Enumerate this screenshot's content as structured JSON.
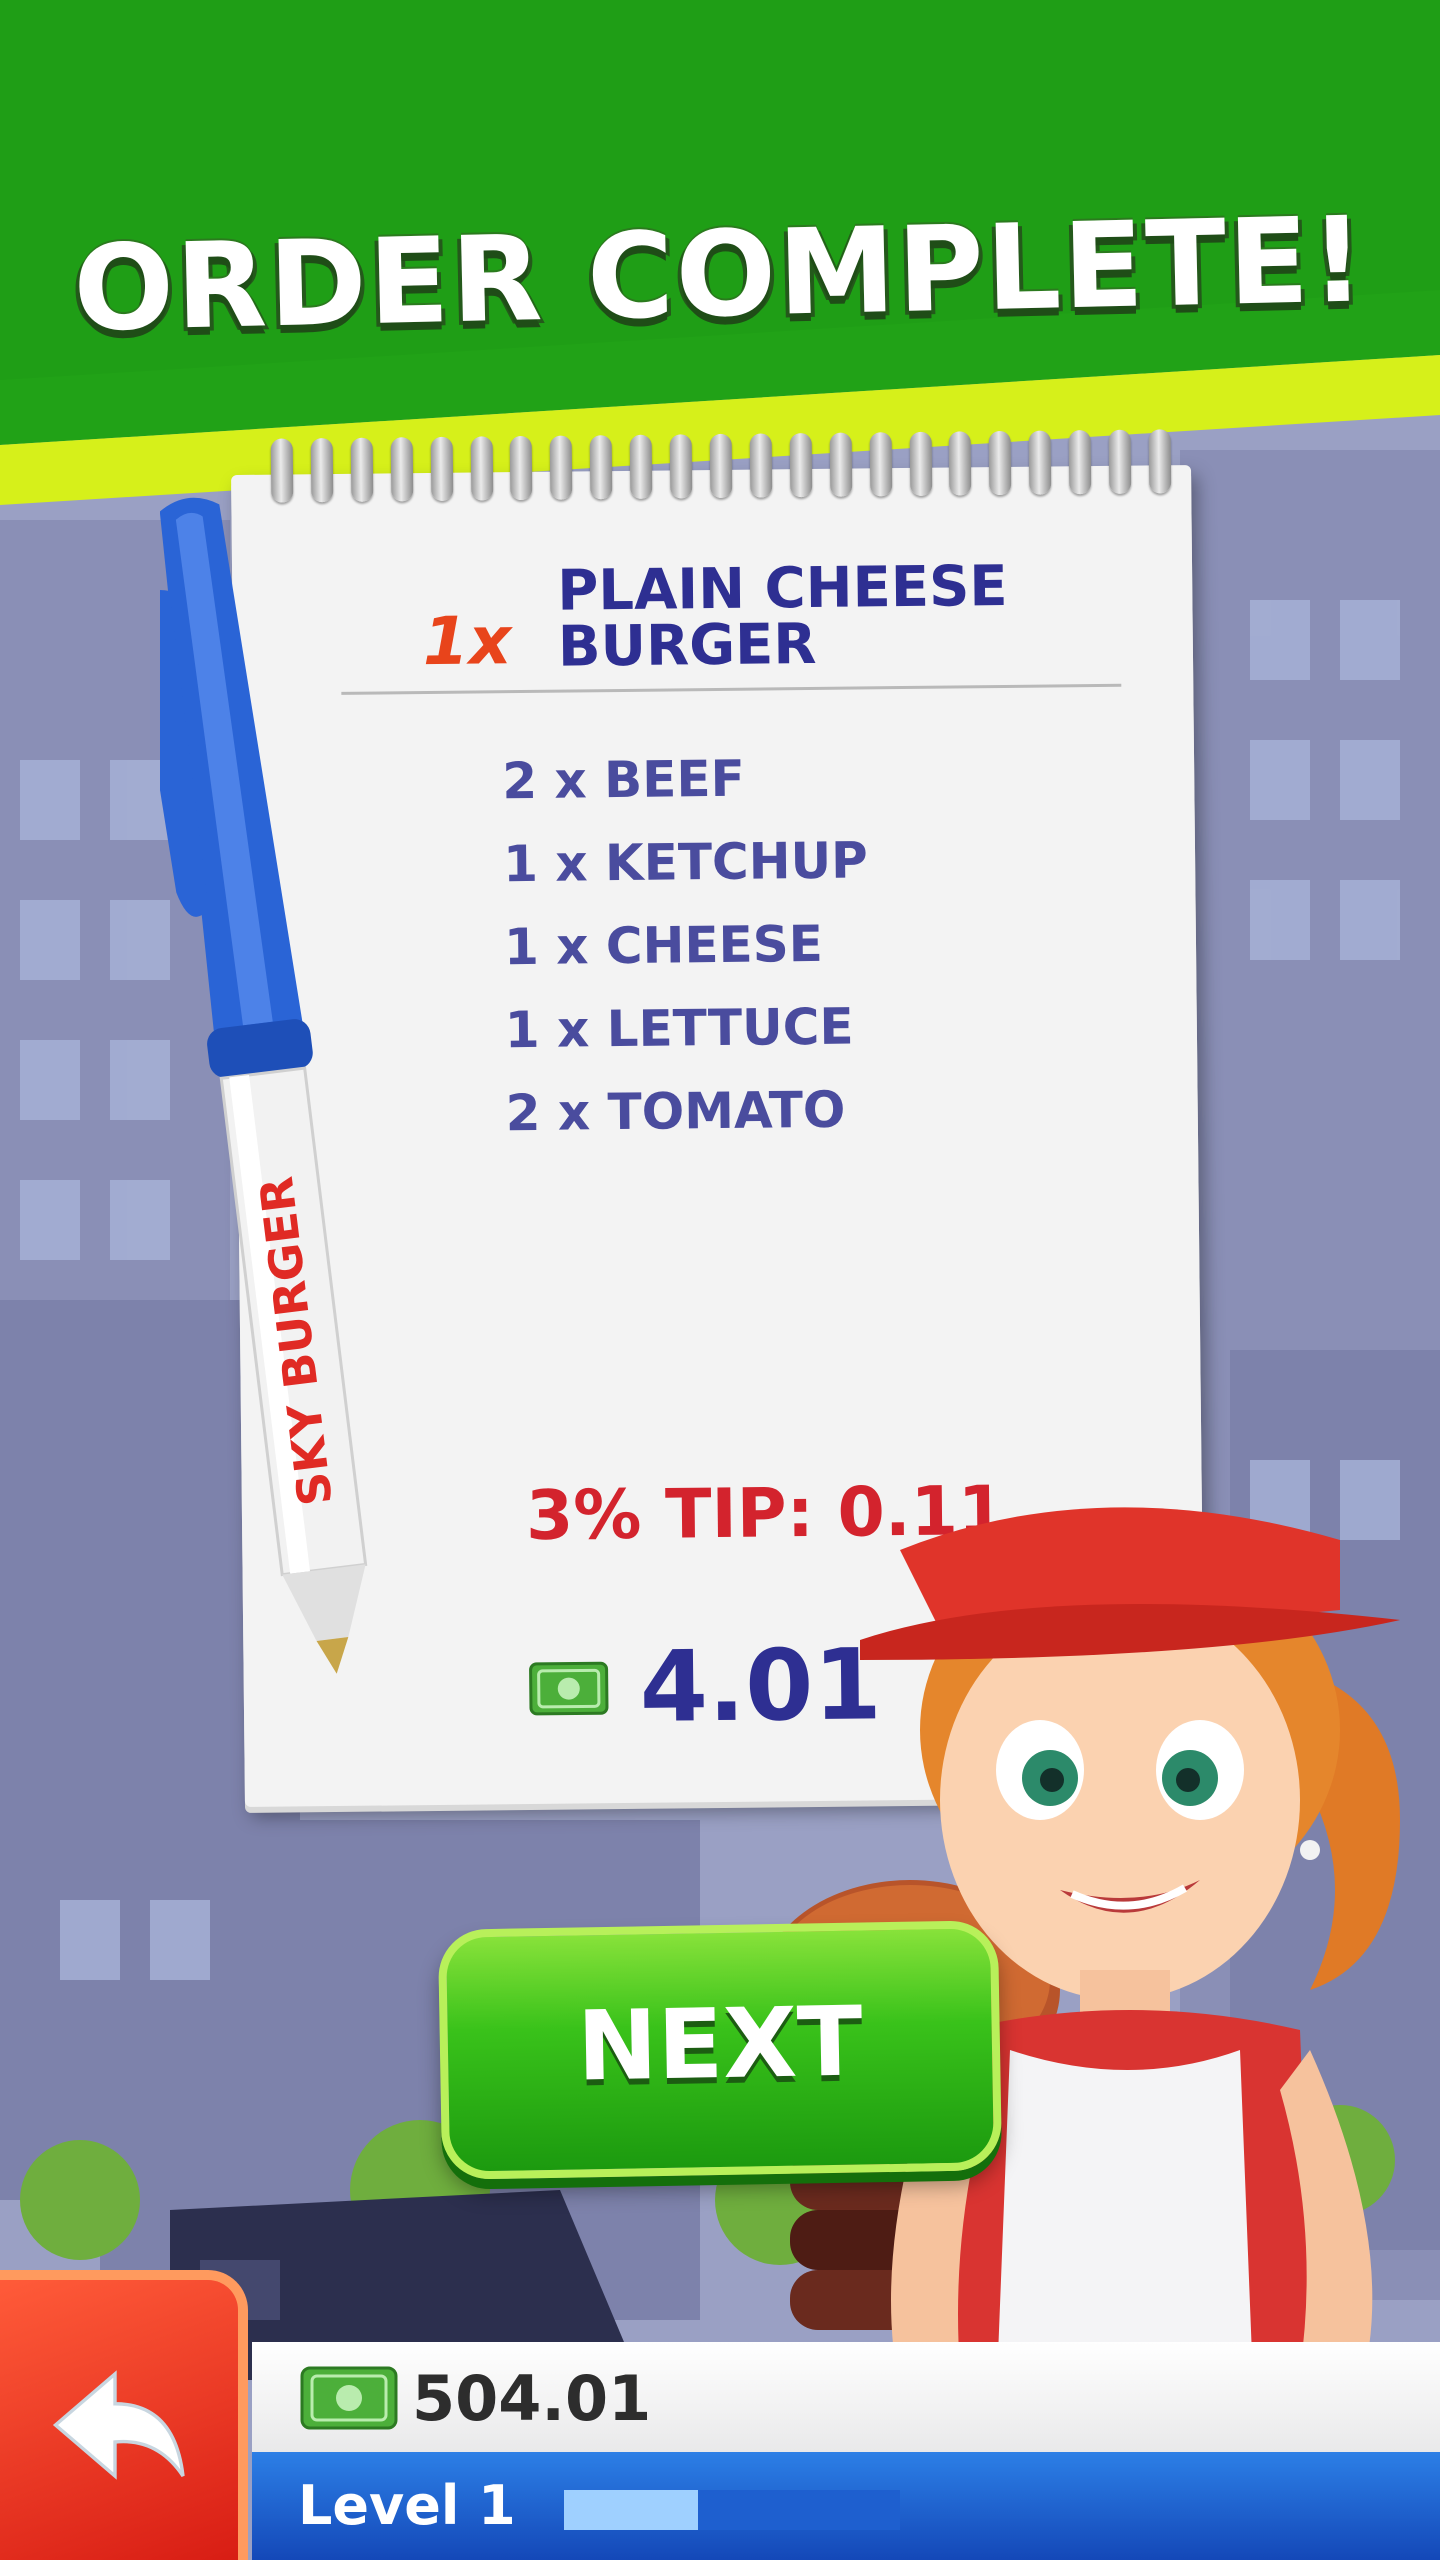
{
  "banner": {
    "title": "ORDER COMPLETE!"
  },
  "order": {
    "quantity": "1x",
    "item_name": "PLAIN CHEESE BURGER",
    "ingredients": [
      "2 x BEEF",
      "1 x KETCHUP",
      "1 x CHEESE",
      "1 x LETTUCE",
      "2 x TOMATO"
    ],
    "tip": "3% TIP: 0.11",
    "total": "4.01"
  },
  "pen": {
    "brand": "SKY BURGER"
  },
  "next_button": {
    "label": "NEXT"
  },
  "hud": {
    "money": "504.01",
    "level_label": "Level 1",
    "level_progress": 0.4
  },
  "colors": {
    "banner_green": "#1f9e16",
    "banner_stripe": "#d6f01a",
    "order_text": "#2e2f92",
    "tip_red": "#d3232d",
    "button_green": "#39c21a"
  },
  "icons": [
    "cash-icon",
    "back-arrow-icon"
  ]
}
